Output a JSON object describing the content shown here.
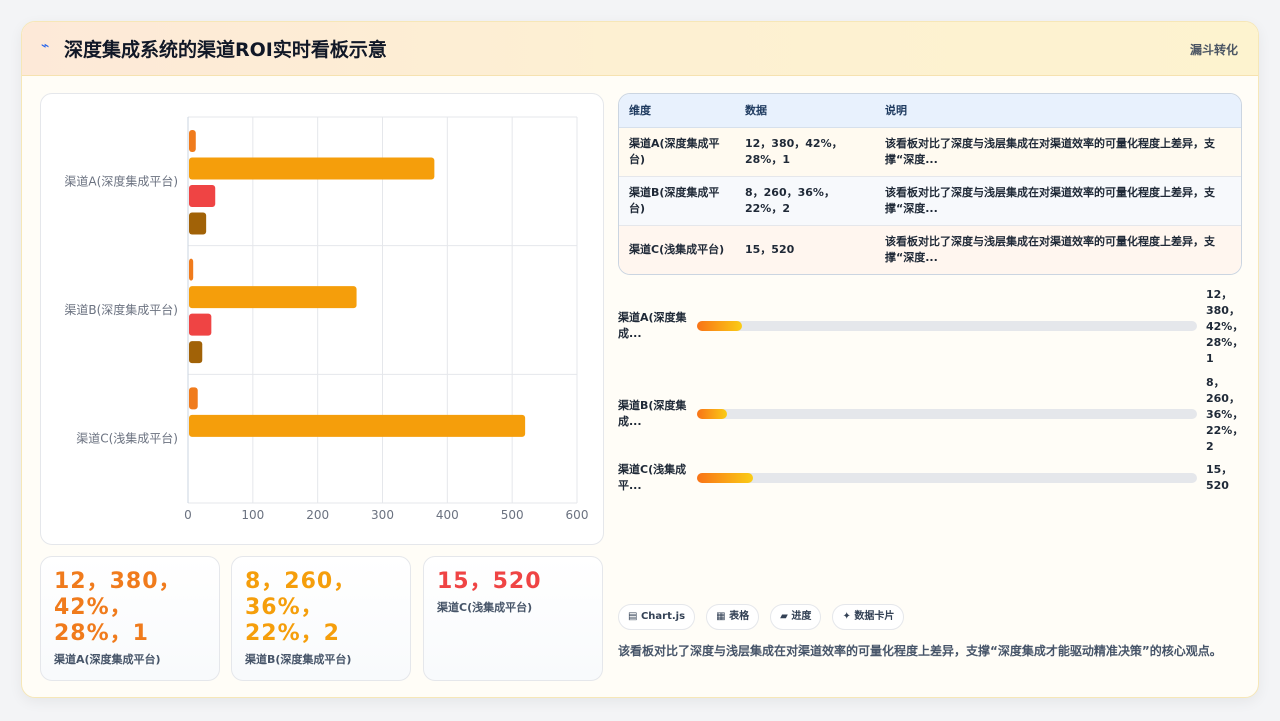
{
  "header": {
    "logo_icon": "⌁",
    "title": "深度集成系统的渠道ROI实时看板示意",
    "tag": "漏斗转化"
  },
  "colors": {
    "orange_dark": "#f07b1c",
    "orange": "#f59e0b",
    "red": "#ef4444",
    "brown": "#a16207"
  },
  "chart_data": {
    "type": "bar",
    "orientation": "horizontal",
    "categories": [
      "渠道A(深度集成平台)",
      "渠道B(深度集成平台)",
      "渠道C(浅集成平台)"
    ],
    "series": [
      {
        "values": [
          12,
          8,
          15
        ],
        "color": "#f07b1c"
      },
      {
        "values": [
          380,
          260,
          520
        ],
        "color": "#f59e0b"
      },
      {
        "values": [
          42,
          36,
          null
        ],
        "color": "#ef4444"
      },
      {
        "values": [
          28,
          22,
          null
        ],
        "color": "#a16207"
      }
    ],
    "xlim": [
      0,
      600
    ],
    "xticks": [
      "0",
      "100",
      "200",
      "300",
      "400",
      "500",
      "600"
    ],
    "grid": true
  },
  "kpis": [
    {
      "value": "12，380，42%，28%，1",
      "label": "渠道A(深度集成平台)",
      "color": "#f07b1c"
    },
    {
      "value": "8，260，36%，22%，2",
      "label": "渠道B(深度集成平台)",
      "color": "#f59e0b"
    },
    {
      "value": "15，520",
      "label": "渠道C(浅集成平台)",
      "color": "#ef4444"
    }
  ],
  "table": {
    "headers": [
      "维度",
      "数据",
      "说明"
    ],
    "rows": [
      [
        "渠道A(深度集成平台)",
        "12，380，42%，28%，1",
        "该看板对比了深度与浅层集成在对渠道效率的可量化程度上差异，支撑“深度..."
      ],
      [
        "渠道B(深度集成平台)",
        "8，260，36%，22%，2",
        "该看板对比了深度与浅层集成在对渠道效率的可量化程度上差异，支撑“深度..."
      ],
      [
        "渠道C(浅集成平台)",
        "15，520",
        "该看板对比了深度与浅层集成在对渠道效率的可量化程度上差异，支撑“深度..."
      ]
    ]
  },
  "progress": [
    {
      "label": "渠道A(深度集成...",
      "value": "12，380，42%，28%，1",
      "fraction": 0.09
    },
    {
      "label": "渠道B(深度集成...",
      "value": "8，260，36%，22%，2",
      "fraction": 0.06
    },
    {
      "label": "渠道C(浅集成平...",
      "value": "15，520",
      "fraction": 0.112
    }
  ],
  "chips": [
    {
      "icon": "▤",
      "label": "Chart.js"
    },
    {
      "icon": "▦",
      "label": "表格"
    },
    {
      "icon": "▰",
      "label": "进度"
    },
    {
      "icon": "✦",
      "label": "数据卡片"
    }
  ],
  "description": "该看板对比了深度与浅层集成在对渠道效率的可量化程度上差异，支撑“深度集成才能驱动精准决策”的核心观点。"
}
